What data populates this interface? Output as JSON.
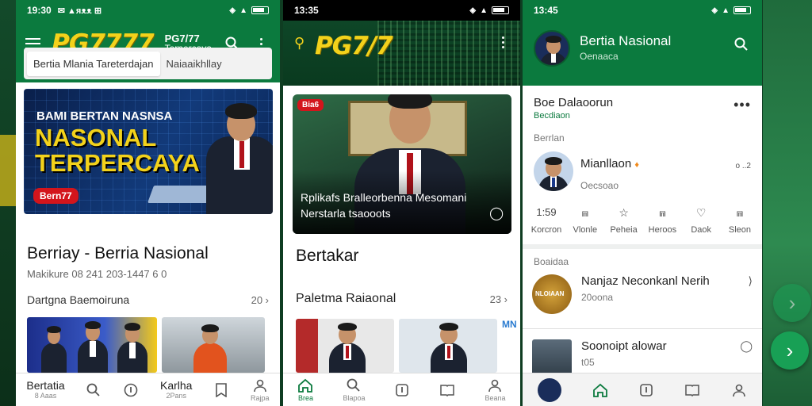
{
  "phone1": {
    "status": {
      "time": "19:30",
      "left_text": "✉ ▲ᴙᴥᴥ ⊞"
    },
    "logo": "PG7777",
    "brand_title": "PG7/77",
    "brand_sub": "Terpercaya",
    "tabs": [
      {
        "label": "Bertia Mlania Tareterdajan",
        "active": true
      },
      {
        "label": "Naiaaikhllay",
        "active": false
      }
    ],
    "hero": {
      "kicker": "BAMI BERTAN NASNSA",
      "headline_1": "NASONAL",
      "headline_2": "TERPERCAYA",
      "badge": "Bern77"
    },
    "title": "Berriay - Berria Nasional",
    "meta": "Makikure 08 241 203-1447 6 0",
    "section": {
      "label": "Dartgna Baemoiruna",
      "more": "20 ›"
    },
    "nav": [
      {
        "icon": "text",
        "label": "Bertatia",
        "sub": "8 Aaas"
      },
      {
        "icon": "search-icon",
        "label": "",
        "sub": ""
      },
      {
        "icon": "info-icon",
        "label": "",
        "sub": ""
      },
      {
        "icon": "text",
        "label": "Karlha",
        "sub": "2Pans"
      },
      {
        "icon": "bookmark-icon",
        "label": "",
        "sub": ""
      },
      {
        "icon": "profile-icon",
        "label": "",
        "sub": "Rajpa"
      }
    ]
  },
  "phone2": {
    "status": {
      "time": "13:35"
    },
    "logo": "PG7/7",
    "hero": {
      "badge": "Bia6",
      "caption": "Rplikafs Bralleorbenna Mesomani Nerstarla tsaooots"
    },
    "title": "Bertakar",
    "section": {
      "label": "Paletma Raiaonal",
      "more": "23 ›"
    },
    "thumb_tag": "MN",
    "nav": [
      {
        "label": "Brea",
        "active": true
      },
      {
        "label": "Blapoa",
        "active": false
      },
      {
        "label": "",
        "active": false
      },
      {
        "label": "",
        "active": false
      },
      {
        "label": "Beana",
        "active": false
      }
    ]
  },
  "phone3": {
    "status": {
      "time": "13:45"
    },
    "page_title": "Bertia Nasional",
    "page_sub": "Oenaaca",
    "profile_name": "Boe Dalaoorun",
    "profile_sub": "Becdiaon",
    "section_1": "Berrlan",
    "user": {
      "name": "Mianllaon",
      "sub": "Oecsoao",
      "ext": "o ..2"
    },
    "actions": [
      {
        "icon": "text",
        "label": "Korcron",
        "value": "1:59"
      },
      {
        "icon": "chart-icon",
        "label": "Vlonle",
        "value": ""
      },
      {
        "icon": "star-icon",
        "label": "Peheia",
        "value": ""
      },
      {
        "icon": "chart-icon",
        "label": "Heroos",
        "value": ""
      },
      {
        "icon": "heart-icon",
        "label": "Daok",
        "value": ""
      },
      {
        "icon": "chart-icon",
        "label": "Sleon",
        "value": ""
      }
    ],
    "section_2": "Boaidaa",
    "articles": [
      {
        "title": "Nanjaz Neconkanl Nerih",
        "sub": "20oona",
        "thumb_text": "NLOIAAN"
      },
      {
        "title": "Soonoipt alowar",
        "sub": "t05",
        "thumb_text": ""
      }
    ],
    "nav": [
      "home-icon",
      "info-icon",
      "bookmark-icon",
      "profile-icon"
    ]
  },
  "colors": {
    "brand_green": "#0b7a3e",
    "logo_yellow": "#f3d21b",
    "badge_red": "#d3151c"
  }
}
